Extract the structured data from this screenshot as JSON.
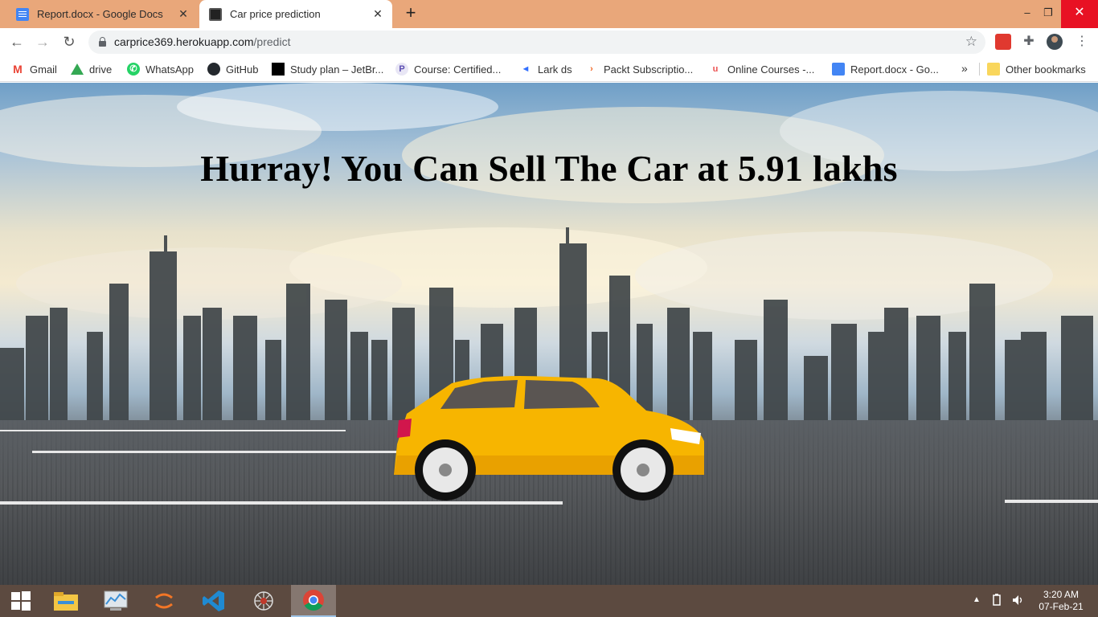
{
  "browser": {
    "tabs": [
      {
        "title": "Report.docx - Google Docs",
        "icon": "google-docs-icon",
        "active": false
      },
      {
        "title": "Car price prediction",
        "icon": "terminal-icon",
        "active": true
      }
    ],
    "url": {
      "host": "carprice369.herokuapp.com",
      "path": "/predict"
    },
    "new_tab": "+",
    "window_controls": {
      "minimize": "–",
      "maximize": "❐",
      "close": "✕"
    }
  },
  "bookmarks": [
    {
      "label": "Gmail",
      "icon": "gmail-icon"
    },
    {
      "label": "drive",
      "icon": "drive-icon"
    },
    {
      "label": "WhatsApp",
      "icon": "whatsapp-icon"
    },
    {
      "label": "GitHub",
      "icon": "github-icon"
    },
    {
      "label": "Study plan – JetBr...",
      "icon": "jetbrains-icon"
    },
    {
      "label": "Course: Certified...",
      "icon": "course-icon"
    },
    {
      "label": "Lark ds",
      "icon": "lark-icon"
    },
    {
      "label": "Packt Subscriptio...",
      "icon": "packt-icon"
    },
    {
      "label": "Online Courses -...",
      "icon": "udemy-icon"
    },
    {
      "label": "Report.docx - Go...",
      "icon": "google-docs-icon"
    }
  ],
  "bookmarks_overflow": "»",
  "other_bookmarks": "Other bookmarks",
  "page": {
    "headline": "Hurray! You Can Sell The Car at 5.91 lakhs"
  },
  "taskbar": {
    "apps": [
      "start-icon",
      "file-explorer-icon",
      "resource-monitor-icon",
      "jupyter-icon",
      "vscode-icon",
      "spider-app-icon",
      "chrome-icon"
    ],
    "clock": {
      "time": "3:20 AM",
      "date": "07-Feb-21"
    }
  },
  "colors": {
    "tabstrip": "#e9a77a",
    "car_body": "#f7b500",
    "taskbar": "#5c4a40"
  }
}
